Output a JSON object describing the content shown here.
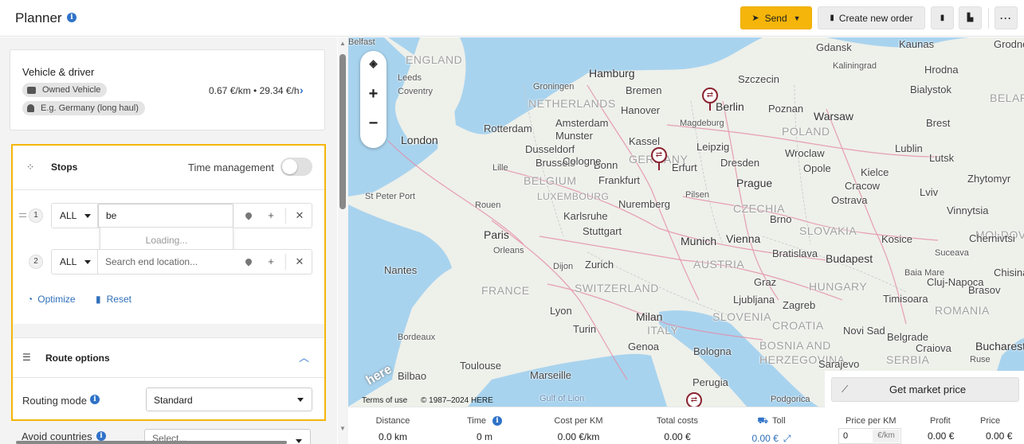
{
  "header": {
    "title": "Planner",
    "send_label": "Send",
    "create_order_label": "Create new order"
  },
  "vehicle": {
    "title": "Vehicle & driver",
    "vehicle_type": "Owned Vehicle",
    "driver_placeholder": "E.g. Germany (long haul)",
    "rate": "0.67 €/km • 29.34 €/h"
  },
  "stops": {
    "title": "Stops",
    "time_management_label": "Time management",
    "time_management_on": false,
    "rows": [
      {
        "number": "1",
        "filter": "ALL",
        "value": "be",
        "placeholder": ""
      },
      {
        "number": "2",
        "filter": "ALL",
        "value": "",
        "placeholder": "Search end location..."
      }
    ],
    "dropdown_status": "Loading...",
    "optimize_label": "Optimize",
    "reset_label": "Reset"
  },
  "route_options": {
    "title": "Route options",
    "routing_mode_label": "Routing mode",
    "routing_mode_value": "Standard",
    "avoid_countries_label": "Avoid countries",
    "avoid_countries_placeholder": "Select..."
  },
  "map": {
    "cities": [
      "Hamburg",
      "Bremen",
      "Berlin",
      "Szczecin",
      "Gdansk",
      "Kaunas",
      "Grodno",
      "Hrodna",
      "Bialystok",
      "Groningen",
      "Amsterdam",
      "Hanover",
      "Magdeburg",
      "Poznan",
      "Warsaw",
      "Brest",
      "Rotterdam",
      "Munster",
      "Leipzig",
      "Wroclaw",
      "Lublin",
      "London",
      "Dusseldorf",
      "Kassel",
      "Dresden",
      "Opole",
      "Lutsk",
      "Brussels",
      "Bonn",
      "Erfurt",
      "Kielce",
      "Lille",
      "Cologne",
      "Frankfurt",
      "Prague",
      "Cracow",
      "Zhytomyr",
      "Pilsen",
      "Lviv",
      "Rouen",
      "Nuremberg",
      "Ostrava",
      "Vinnytsia",
      "Karlsruhe",
      "Paris",
      "Stuttgart",
      "Brno",
      "Munich",
      "Vienna",
      "Chernivtsi",
      "Orleans",
      "Zurich",
      "Bratislava",
      "Kosice",
      "Suceava",
      "Nantes",
      "Dijon",
      "Budapest",
      "Baia Mare",
      "Chisinau",
      "Cluj-Napoca",
      "Graz",
      "Lyon",
      "Ljubljana",
      "Timisoara",
      "Brasov",
      "Milan",
      "Turin",
      "Zagreb",
      "Novi Sad",
      "Bordeaux",
      "Genoa",
      "Bologna",
      "Belgrade",
      "Craiova",
      "Bucharest",
      "Toulouse",
      "Marseille",
      "Sarajevo",
      "Bilbao",
      "Perugia",
      "Podgorica",
      "Belfast",
      "Leeds",
      "Coventry",
      "Kaliningrad",
      "St Peter Port",
      "Ruse"
    ],
    "regions": [
      "ENGLAND",
      "NETHERLANDS",
      "BELGIUM",
      "LUXEMBOURG",
      "GERMANY",
      "POLAND",
      "BELARUS",
      "CZECHIA",
      "SLOVAKIA",
      "FRANCE",
      "SWITZERLAND",
      "AUSTRIA",
      "HUNGARY",
      "MOLDOVA",
      "ITALY",
      "SLOVENIA",
      "CROATIA",
      "ROMANIA",
      "BOSNIA AND HERZEGOVINA",
      "SERBIA",
      "Gulf of Lion"
    ],
    "terms_label": "Terms of use",
    "copyright": "© 1987–2024 HERE",
    "provider_logo_text": "here"
  },
  "market": {
    "button_label": "Get market price",
    "price_per_km_label": "Price per KM",
    "price_per_km_value": "0",
    "price_per_km_unit": "€/km",
    "profit_label": "Profit",
    "profit_value": "0.00 €",
    "price_label": "Price",
    "price_value": "0.00 €"
  },
  "stats": [
    {
      "label": "Distance",
      "value": "0.0 km"
    },
    {
      "label": "Time",
      "value": "0 m"
    },
    {
      "label": "Cost per KM",
      "value": "0.00 €/km"
    },
    {
      "label": "Total costs",
      "value": "0.00 €"
    },
    {
      "label": "Toll",
      "value": "0.00 €"
    }
  ],
  "colors": {
    "accent": "#f5b50a",
    "link": "#2f6fba",
    "pin": "#8a2330",
    "water": "#a8d3ee",
    "land": "#eef0ea",
    "roads": "#e48aa5"
  }
}
